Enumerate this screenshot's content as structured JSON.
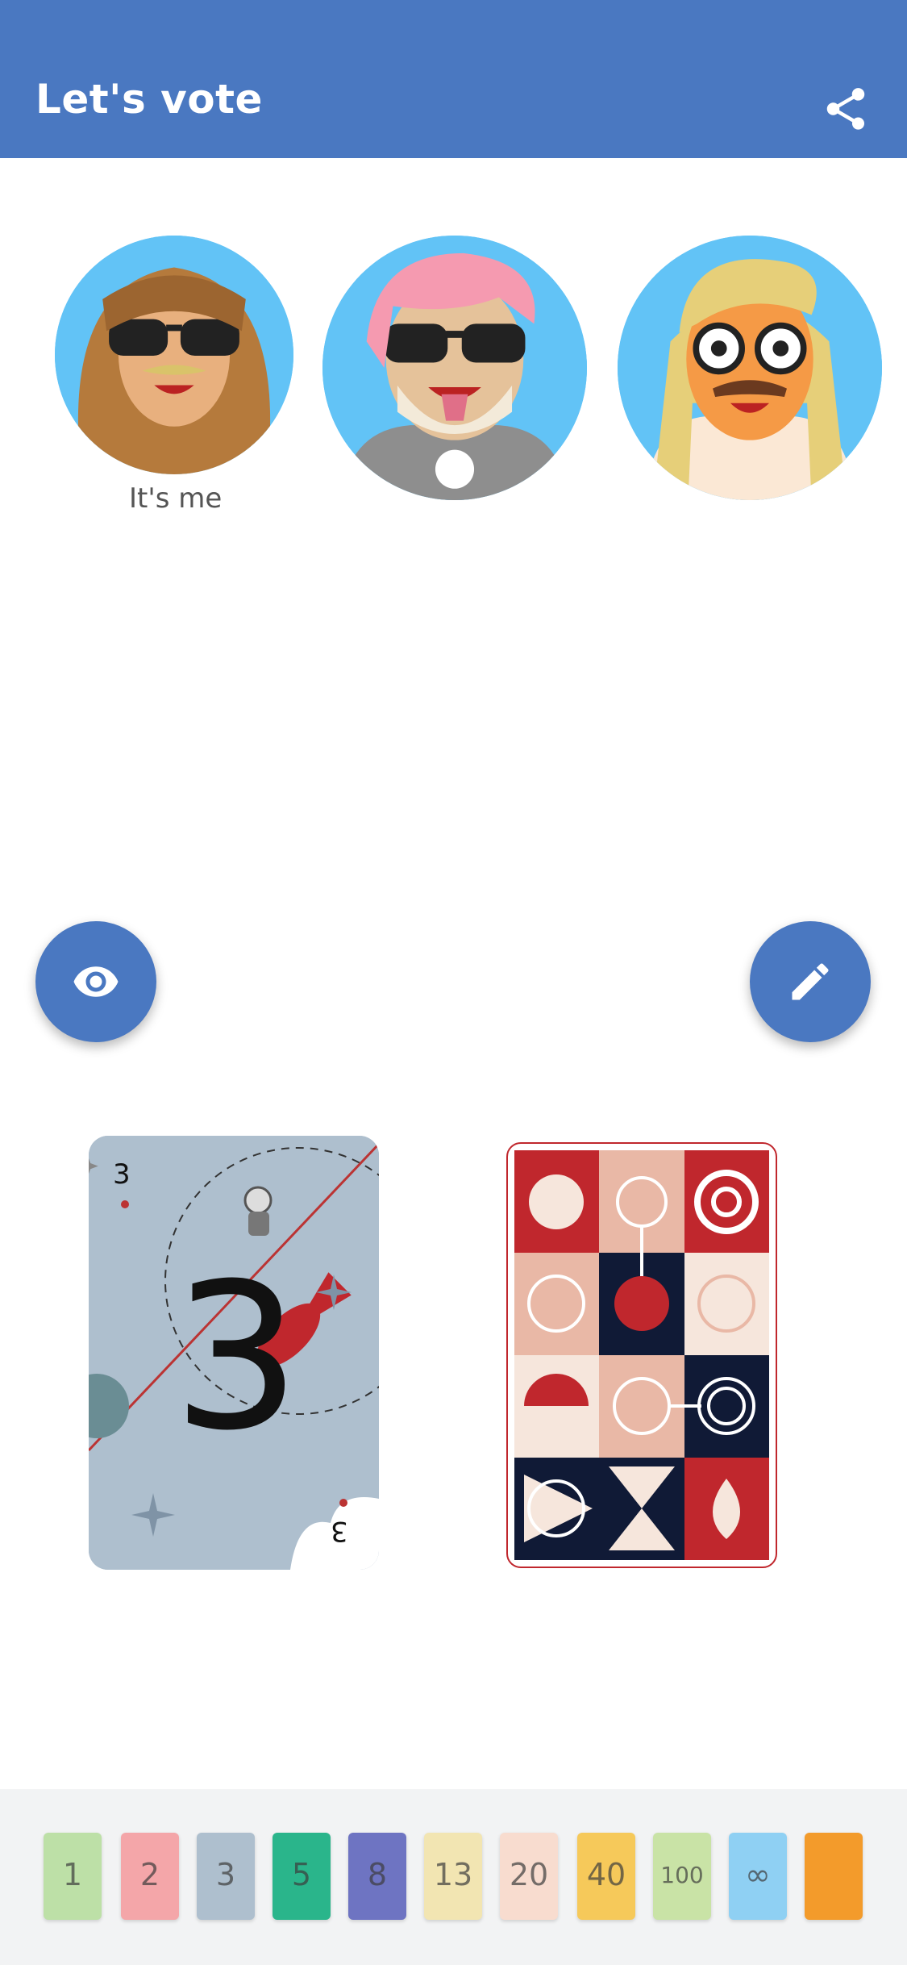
{
  "header": {
    "title": "Let's vote",
    "share_icon": "share-icon"
  },
  "players": [
    {
      "name": "self",
      "label": "It's me"
    },
    {
      "name": "player-2"
    },
    {
      "name": "player-3"
    }
  ],
  "actions": {
    "reveal_icon": "eye-icon",
    "edit_icon": "pencil-icon"
  },
  "table": {
    "played_card_value": "3"
  },
  "hand": [
    "1",
    "2",
    "3",
    "5",
    "8",
    "13",
    "20",
    "40",
    "100",
    "∞",
    ""
  ],
  "colors": {
    "primary": "#4a78c1",
    "avatar_bg": "#62c3f6",
    "card_back_red": "#c0272d",
    "card_back_navy": "#101a36"
  }
}
